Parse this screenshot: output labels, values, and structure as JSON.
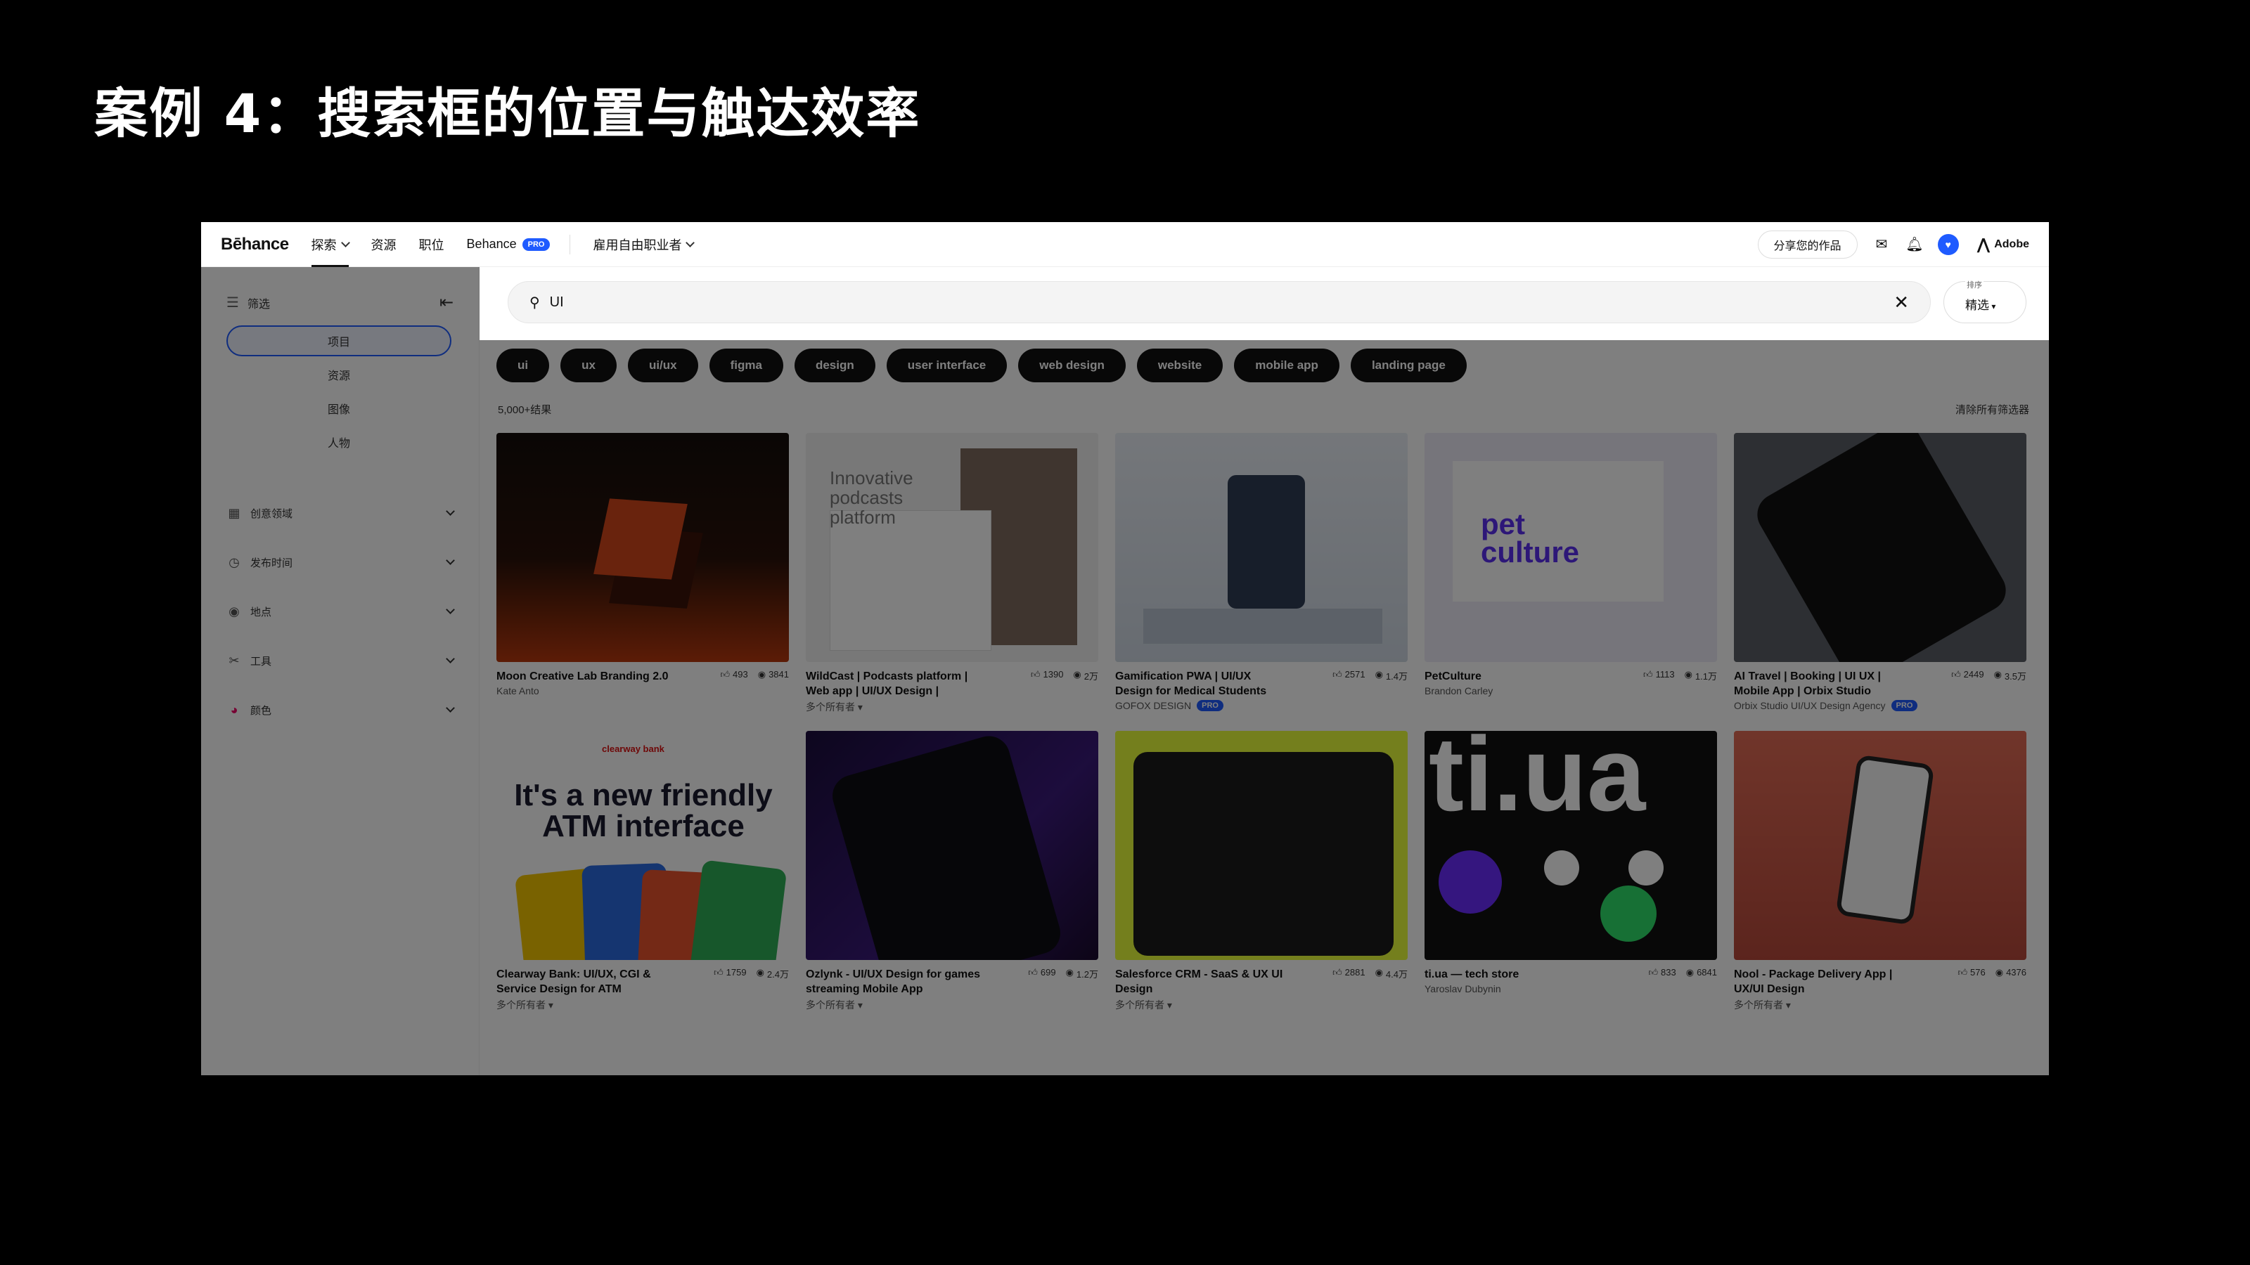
{
  "slide": {
    "title": "案例 4：搜索框的位置与触达效率"
  },
  "topnav": {
    "logo": "Bēhance",
    "items": [
      {
        "label": "探索",
        "active": true,
        "chevron": true
      },
      {
        "label": "资源"
      },
      {
        "label": "职位"
      },
      {
        "label": "Behance",
        "badge": "PRO"
      },
      {
        "label": "雇用自由职业者",
        "chevron": true
      }
    ],
    "share_label": "分享您的作品",
    "icons": [
      "mail-icon",
      "bell-icon",
      "avatar",
      "adobe-logo"
    ],
    "adobe_label": "Adobe"
  },
  "sidebar": {
    "filter_label": "筛选",
    "segments": [
      {
        "label": "项目",
        "active": true
      },
      {
        "label": "资源"
      },
      {
        "label": "图像"
      },
      {
        "label": "人物"
      }
    ],
    "facets": [
      {
        "label": "创意领域",
        "icon": "grid-icon"
      },
      {
        "label": "发布时间",
        "icon": "clock-icon"
      },
      {
        "label": "地点",
        "icon": "location-icon"
      },
      {
        "label": "工具",
        "icon": "tools-icon"
      },
      {
        "label": "颜色",
        "icon": "color-icon"
      }
    ]
  },
  "search": {
    "query": "UI",
    "sort_label": "排序",
    "sort_value": "精选"
  },
  "tags": [
    "ui",
    "ux",
    "ui/ux",
    "figma",
    "design",
    "user interface",
    "web design",
    "website",
    "mobile app",
    "landing page"
  ],
  "results": {
    "count": "5,000+结果",
    "clear_all": "清除所有筛选器"
  },
  "projects": [
    {
      "title": "Moon Creative Lab Branding 2.0",
      "owner": "Kate Anto",
      "likes": "493",
      "views": "3841"
    },
    {
      "title": "WildCast | Podcasts platform | Web app | UI/UX Design |",
      "owner": "多个所有者 ▾",
      "likes": "1390",
      "views": "2万",
      "thumb_text": "Innovative podcasts platform"
    },
    {
      "title": "Gamification PWA | UI/UX Design for Medical Students",
      "owner": "GOFOX DESIGN",
      "owner_badge": "PRO",
      "likes": "2571",
      "views": "1.4万"
    },
    {
      "title": "PetCulture",
      "owner": "Brandon Carley",
      "likes": "1113",
      "views": "1.1万",
      "thumb_text": "pet culture"
    },
    {
      "title": "AI Travel | Booking | UI UX | Mobile App | Orbix Studio",
      "owner": "Orbix Studio UI/UX Design Agency",
      "owner_badge": "PRO",
      "likes": "2449",
      "views": "3.5万"
    },
    {
      "title": "Clearway Bank: UI/UX, CGI & Service Design for ATM",
      "owner": "多个所有者 ▾",
      "likes": "1759",
      "views": "2.4万",
      "thumb_brand": "clearway bank",
      "thumb_text": "It's a new friendly ATM interface"
    },
    {
      "title": "Ozlynk - UI/UX Design for games streaming Mobile App",
      "owner": "多个所有者 ▾",
      "likes": "699",
      "views": "1.2万"
    },
    {
      "title": "Salesforce CRM - SaaS & UX UI Design",
      "owner": "多个所有者 ▾",
      "likes": "2881",
      "views": "4.4万"
    },
    {
      "title": "ti.ua — tech store",
      "owner": "Yaroslav Dubynin",
      "likes": "833",
      "views": "6841",
      "thumb_text": "ti.ua"
    },
    {
      "title": "Nool - Package Delivery App | UX/UI Design",
      "owner": "多个所有者 ▾",
      "likes": "576",
      "views": "4376"
    }
  ]
}
